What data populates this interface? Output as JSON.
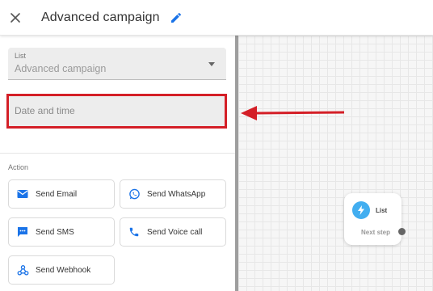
{
  "header": {
    "title": "Advanced campaign",
    "close_icon": "close-icon",
    "edit_icon": "pencil-icon"
  },
  "form": {
    "list_label": "List",
    "list_value": "Advanced campaign",
    "datetime_placeholder": "Date and time"
  },
  "actions": {
    "section_label": "Action",
    "items": [
      {
        "label": "Send Email",
        "icon": "email-icon",
        "color": "#1a73e8"
      },
      {
        "label": "Send WhatsApp",
        "icon": "whatsapp-icon",
        "color": "#1a73e8"
      },
      {
        "label": "Send SMS",
        "icon": "sms-icon",
        "color": "#1a73e8"
      },
      {
        "label": "Send Voice call",
        "icon": "phone-icon",
        "color": "#1a73e8"
      },
      {
        "label": "Send Webhook",
        "icon": "webhook-icon",
        "color": "#1a73e8"
      }
    ]
  },
  "canvas_node": {
    "title": "List",
    "next_label": "Next step",
    "icon": "lightning-icon",
    "icon_color": "#42aef0"
  },
  "colors": {
    "accent": "#1a73e8",
    "highlight": "#d41f27"
  }
}
